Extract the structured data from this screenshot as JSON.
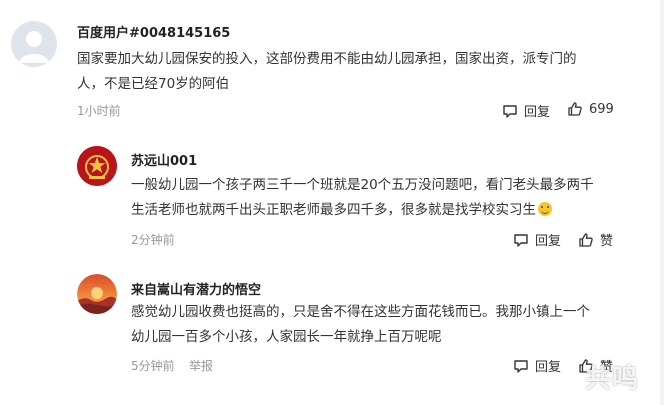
{
  "comments": [
    {
      "username": "百度用户#0048145165",
      "content_lines": [
        "国家要加大幼儿园保安的投入，这部份费用不能由幼儿园承担，国家出资，派专门的",
        "人，不是已经70岁的阿伯"
      ],
      "time": "1小时前",
      "reply_label": "回复",
      "like_label": "699",
      "avatar_icon": "default-user-icon"
    },
    {
      "username": "苏远山001",
      "content_lines": [
        "一般幼儿园一个孩子两三千一个班就是20个五万没问题吧，看门老头最多两千",
        "生活老师也就两千出头正职老师最多四千多，很多就是找学校实习生"
      ],
      "emoji": "smile-emoji-icon",
      "time": "2分钟前",
      "reply_label": "回复",
      "like_label": "赞",
      "avatar_icon": "red-emblem-avatar"
    },
    {
      "username": "来自嵩山有潜力的悟空",
      "content_lines": [
        "感觉幼儿园收费也挺高的，只是舍不得在这些方面花钱而已。我那小镇上一个",
        "幼儿园一百多个小孩，人家园长一年就挣上百万呢呢"
      ],
      "time": "5分钟前",
      "report_label": "举报",
      "reply_label": "回复",
      "like_label": "赞",
      "avatar_icon": "sunset-avatar"
    }
  ],
  "watermark": "共鸣",
  "colors": {
    "text": "#333333",
    "meta": "#999999",
    "avatar_default": "#dfe3eb"
  }
}
